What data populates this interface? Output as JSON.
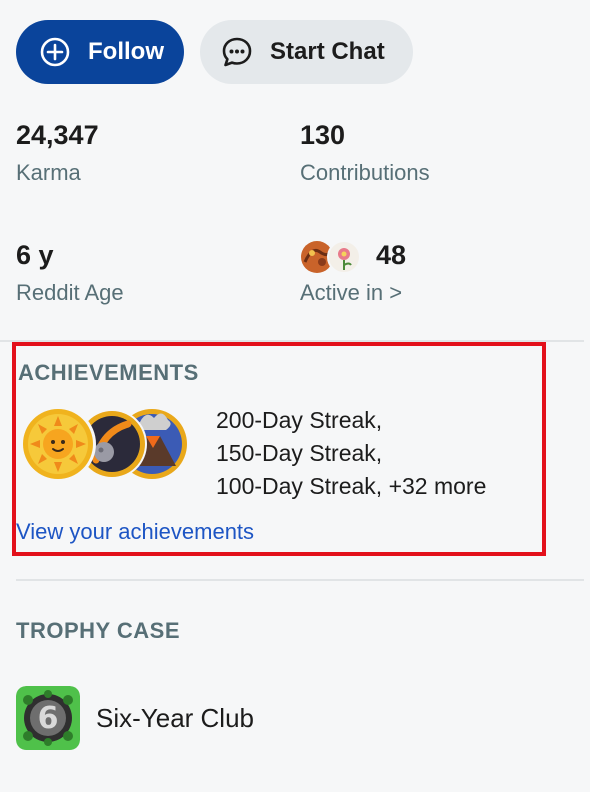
{
  "actions": {
    "follow_label": "Follow",
    "chat_label": "Start Chat"
  },
  "stats": {
    "karma_value": "24,347",
    "karma_label": "Karma",
    "contributions_value": "130",
    "contributions_label": "Contributions",
    "age_value": "6 y",
    "age_label": "Reddit Age",
    "active_value": "48",
    "active_label": "Active in >"
  },
  "achievements": {
    "heading": "ACHIEVEMENTS",
    "lines": [
      "200-Day Streak,",
      "150-Day Streak,",
      "100-Day Streak, +32 more"
    ],
    "link": "View your achievements"
  },
  "trophy_case": {
    "heading": "TROPHY CASE",
    "items": [
      {
        "name": "Six-Year Club",
        "icon": "six-year-club-icon"
      }
    ]
  },
  "colors": {
    "follow_bg": "#0a449b",
    "chat_bg": "#e4e8eb",
    "link": "#1d55c4",
    "highlight": "#e3101b",
    "muted_text": "#576f76"
  }
}
